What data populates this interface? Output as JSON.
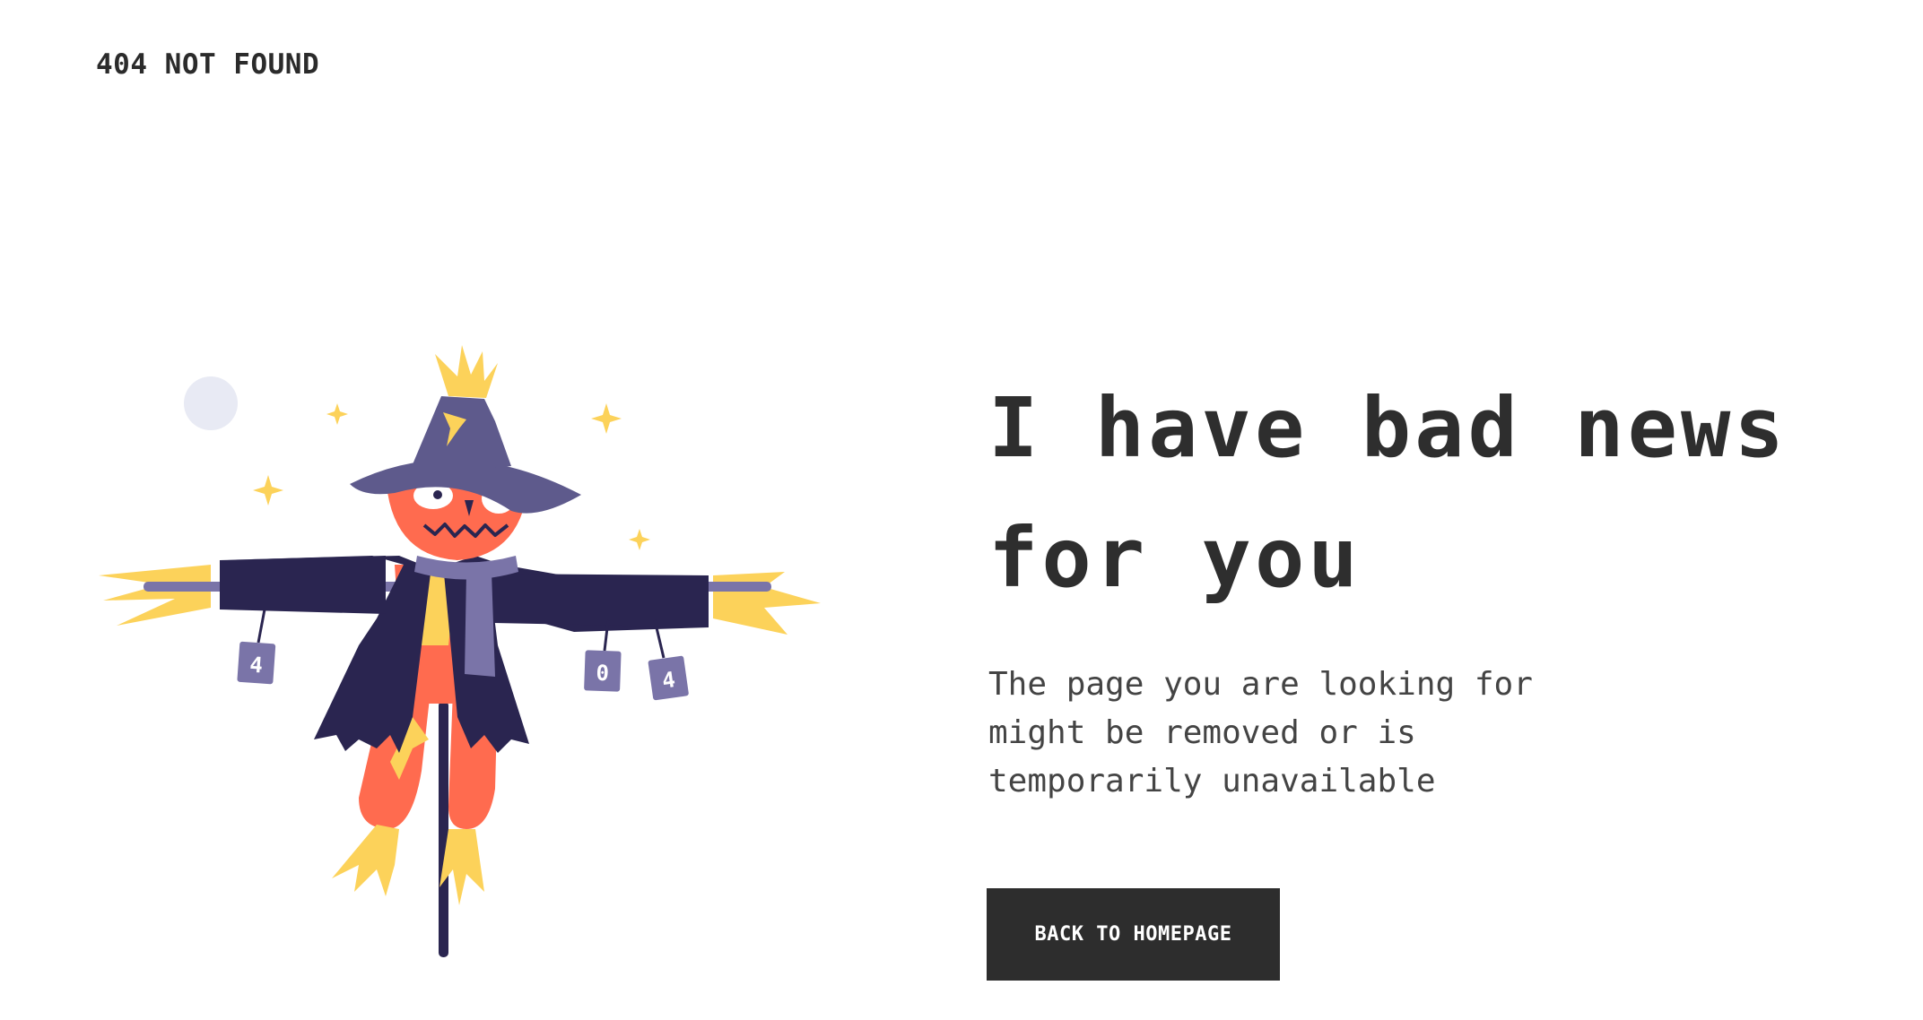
{
  "header": {
    "status_label": "404 NOT FOUND"
  },
  "main": {
    "headline": "I have bad news for you",
    "description": "The page you are looking for might be removed or is temporarily unavailable",
    "back_button_label": "BACK TO HOMEPAGE"
  },
  "illustration": {
    "can_labels": [
      "4",
      "0",
      "4"
    ]
  },
  "colors": {
    "text_dark": "#2e2e2e",
    "button_bg": "#2d2d2d",
    "hat": "#5e5a8c",
    "coat": "#2a2550",
    "face": "#ff6b4f",
    "straw": "#fcd25a",
    "moon": "#e8eaf4"
  }
}
